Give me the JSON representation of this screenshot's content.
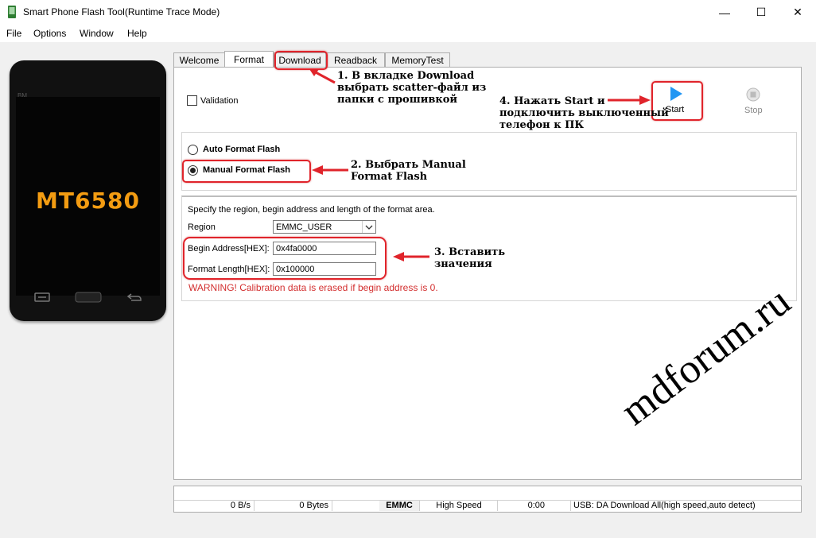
{
  "window": {
    "title": "Smart Phone Flash Tool(Runtime Trace Mode)",
    "minimize": "—",
    "maximize": "☐",
    "close": "✕"
  },
  "menu": [
    "File",
    "Options",
    "Window",
    "Help"
  ],
  "phone": {
    "brand": "BM",
    "model": "MT6580"
  },
  "tabs": [
    "Welcome",
    "Format",
    "Download",
    "Readback",
    "MemoryTest"
  ],
  "format_tab": {
    "validation_label": "Validation",
    "start_label": "Start",
    "stop_label": "Stop",
    "auto_format_label": "Auto Format Flash",
    "manual_format_label": "Manual Format Flash",
    "instructions": "Specify the region, begin address and length of the format area.",
    "region_label": "Region",
    "region_value": "EMMC_USER",
    "begin_label": "Begin Address[HEX]:",
    "begin_value": "0x4fa0000",
    "length_label": "Format Length[HEX]:",
    "length_value": "0x100000",
    "warning": "WARNING! Calibration data is erased if begin address is 0."
  },
  "annotations": {
    "step1": "1. В вкладке Download\nвыбрать scatter-файл из\nпапки с прошивкой",
    "step2": "2. Выбрать Manual\nFormat Flash",
    "step3": "3. Вставить\nзначения",
    "step4": "4. Нажать Start и\nподключить выключенный\nтелефон к ПК"
  },
  "status": {
    "speed": "0 B/s",
    "bytes": "0 Bytes",
    "storage": "EMMC",
    "mode": "High Speed",
    "time": "0:00",
    "usb": "USB: DA Download All(high speed,auto detect)"
  },
  "watermark": "mdforum.ru",
  "colors": {
    "annotation_red": "#e0242b",
    "warning_red": "#d32f2f",
    "phone_model": "#f39c12",
    "start_blue": "#2196f3"
  }
}
